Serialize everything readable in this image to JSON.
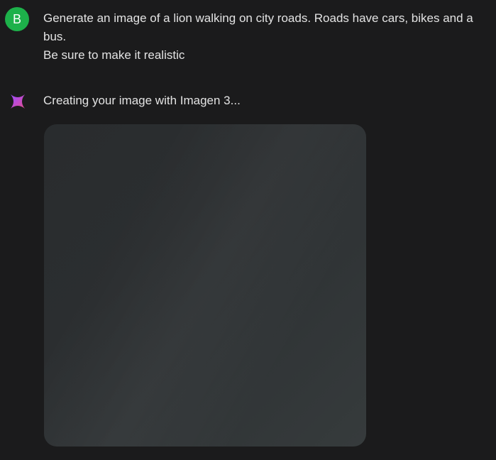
{
  "user_message": {
    "avatar_initial": "B",
    "avatar_color": "#1db14a",
    "text": "Generate an image of a lion walking on city roads. Roads have cars, bikes and a bus.\nBe sure to make it realistic"
  },
  "model_response": {
    "icon": "gemini-spark-icon",
    "status": "Creating your image with Imagen 3...",
    "image_state": "loading"
  }
}
